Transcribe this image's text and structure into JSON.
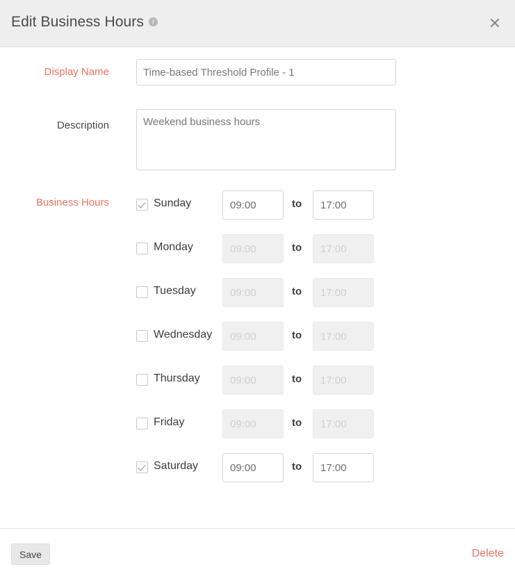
{
  "header": {
    "title": "Edit Business Hours",
    "info_icon_glyph": "i",
    "close_icon": "✕"
  },
  "form": {
    "display_name": {
      "label": "Display Name",
      "required": true,
      "value": "Time-based Threshold Profile - 1",
      "placeholder": ""
    },
    "description": {
      "label": "Description",
      "required": false,
      "value": "Weekend business hours",
      "placeholder": ""
    },
    "business_hours": {
      "label": "Business Hours",
      "required": true,
      "to_label": "to",
      "days": [
        {
          "name": "Sunday",
          "checked": true,
          "from": "09:00",
          "to": "17:00"
        },
        {
          "name": "Monday",
          "checked": false,
          "from": "09:00",
          "to": "17:00"
        },
        {
          "name": "Tuesday",
          "checked": false,
          "from": "09:00",
          "to": "17:00"
        },
        {
          "name": "Wednesday",
          "checked": false,
          "from": "09:00",
          "to": "17:00"
        },
        {
          "name": "Thursday",
          "checked": false,
          "from": "09:00",
          "to": "17:00"
        },
        {
          "name": "Friday",
          "checked": false,
          "from": "09:00",
          "to": "17:00"
        },
        {
          "name": "Saturday",
          "checked": true,
          "from": "09:00",
          "to": "17:00"
        }
      ]
    }
  },
  "footer": {
    "save_label": "Save",
    "delete_label": "Delete"
  },
  "colors": {
    "required_label": "#f0705f",
    "delete_link": "#f0705f",
    "header_background": "#eeeeee",
    "body_text": "#4a4a4a",
    "input_border": "#d6d6d6",
    "disabled_input_background": "#f0f0f0"
  }
}
